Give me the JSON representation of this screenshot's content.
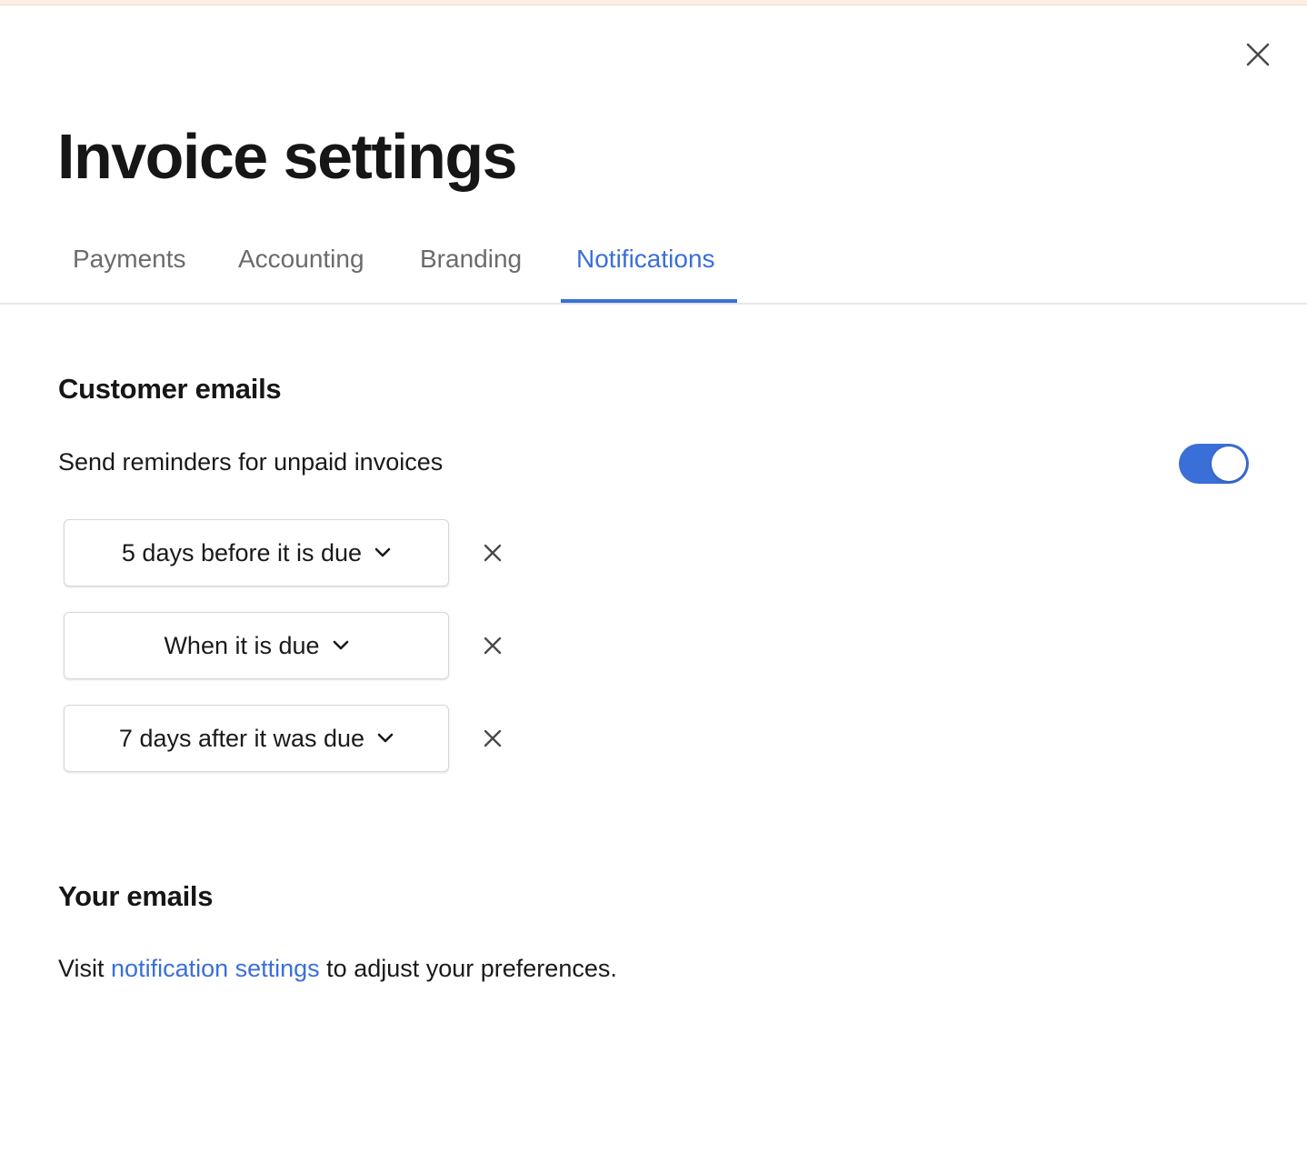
{
  "window": {
    "close_icon": "close-icon"
  },
  "header": {
    "title": "Invoice settings"
  },
  "tabs": [
    {
      "label": "Payments",
      "active": false
    },
    {
      "label": "Accounting",
      "active": false
    },
    {
      "label": "Branding",
      "active": false
    },
    {
      "label": "Notifications",
      "active": true
    }
  ],
  "colors": {
    "accent": "#3b6fd8",
    "text": "#1a1a1a",
    "muted_tab": "#6b6b6b",
    "divider": "#e4e6ea"
  },
  "customer_emails": {
    "title": "Customer emails",
    "reminder_label": "Send reminders for unpaid invoices",
    "reminders_enabled": true,
    "rules": [
      {
        "label": "5 days before it is due",
        "icon": "chevron-down-icon",
        "remove_icon": "close-icon"
      },
      {
        "label": "When it is due",
        "icon": "chevron-down-icon",
        "remove_icon": "close-icon"
      },
      {
        "label": "7 days after it was due",
        "icon": "chevron-down-icon",
        "remove_icon": "close-icon"
      }
    ]
  },
  "your_emails": {
    "title": "Your emails",
    "text_before": "Visit ",
    "link_text": "notification settings",
    "text_after": " to adjust your preferences."
  }
}
